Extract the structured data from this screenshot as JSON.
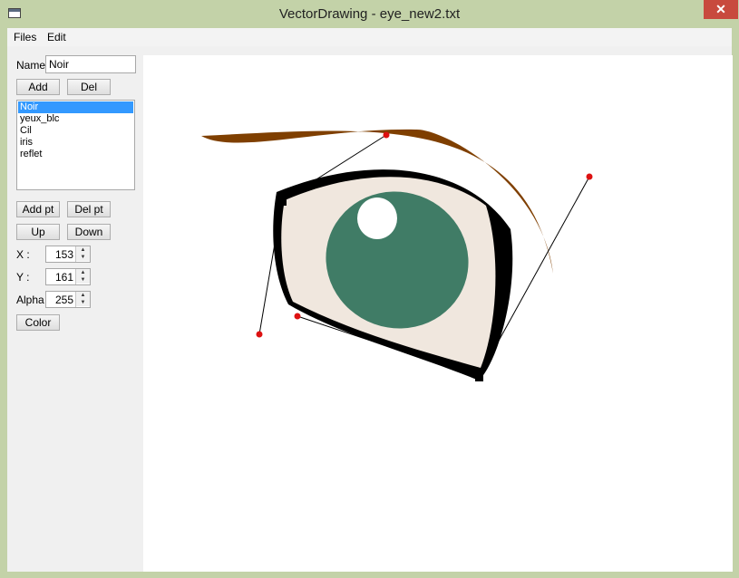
{
  "window": {
    "title": "VectorDrawing - eye_new2.txt",
    "close_glyph": "✕"
  },
  "menu": {
    "files": "Files",
    "edit": "Edit"
  },
  "panel": {
    "name_label": "Name",
    "name_value": "Noir",
    "add_button": "Add",
    "del_button": "Del",
    "layers": [
      "Noir",
      "yeux_blc",
      "Cil",
      "iris",
      "reflet"
    ],
    "selected_layer": "Noir",
    "add_pt_button": "Add pt",
    "del_pt_button": "Del pt",
    "up_button": "Up",
    "down_button": "Down",
    "x_label": "X :",
    "x_value": "153",
    "y_label": "Y :",
    "y_value": "161",
    "alpha_label": "Alpha",
    "alpha_value": "255",
    "color_button": "Color"
  },
  "colors": {
    "eyebrow": "#7f3f00",
    "eye_white": "#f0e7de",
    "eye_outline": "#000000",
    "iris": "#407c66",
    "reflet": "#ffffff",
    "control_point": "#dd1111",
    "selection": "#3399ff"
  }
}
